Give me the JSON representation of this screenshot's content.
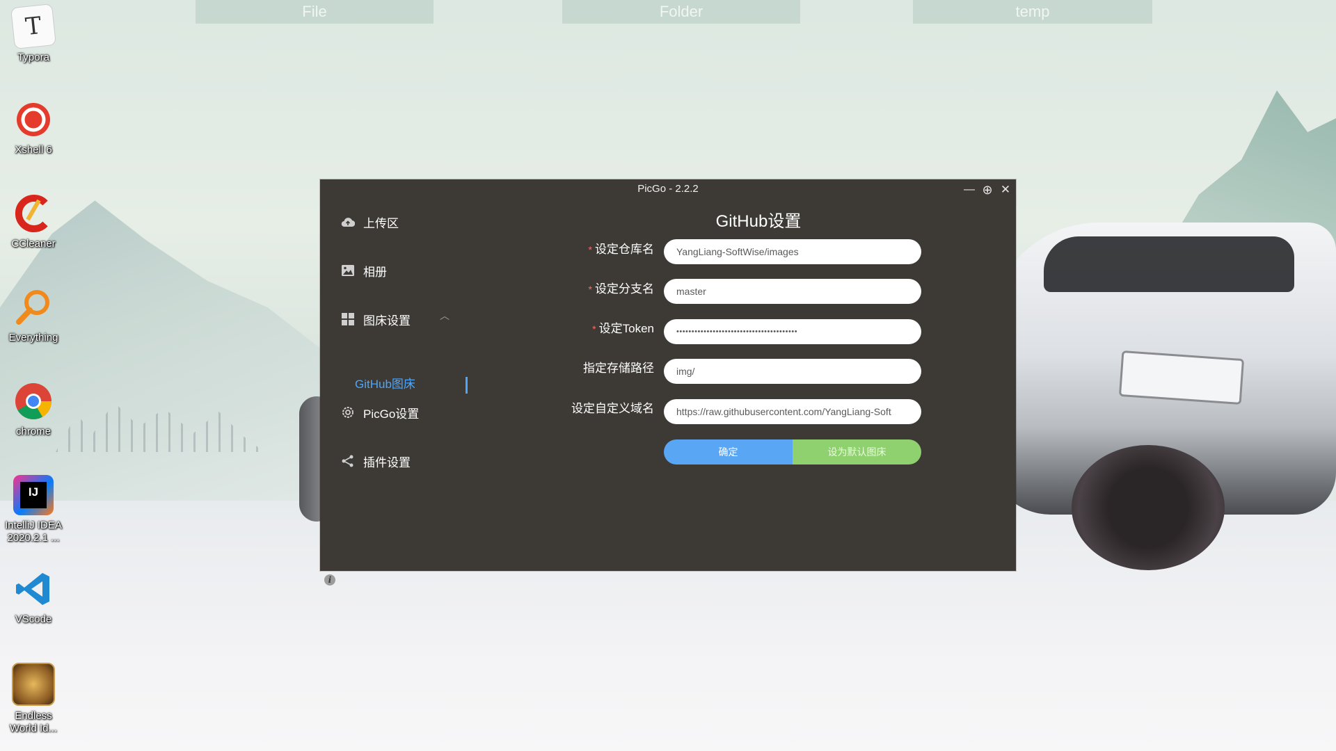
{
  "desktop": {
    "top_folders": [
      "File",
      "Folder",
      "temp"
    ],
    "icons": [
      {
        "label": "Typora",
        "icon": "typora-icon"
      },
      {
        "label": "Xshell 6",
        "icon": "xshell-icon"
      },
      {
        "label": "CCleaner",
        "icon": "ccleaner-icon"
      },
      {
        "label": "Everything",
        "icon": "everything-icon"
      },
      {
        "label": "chrome",
        "icon": "chrome-icon"
      },
      {
        "label": "IntelliJ IDEA\n2020.2.1 ...",
        "icon": "intellij-icon"
      },
      {
        "label": "VScode",
        "icon": "vscode-icon"
      },
      {
        "label": "Endless\nWorld Id...",
        "icon": "endless-world-icon"
      }
    ]
  },
  "window": {
    "title": "PicGo - 2.2.2",
    "controls": {
      "minimize": "—",
      "maximize": "⊕",
      "close": "✕"
    }
  },
  "sidebar": {
    "items": [
      {
        "label": "上传区",
        "icon": "cloud-upload-icon"
      },
      {
        "label": "相册",
        "icon": "picture-icon"
      },
      {
        "label": "图床设置",
        "icon": "grid-icon"
      },
      {
        "label": "PicGo设置",
        "icon": "gear-icon"
      },
      {
        "label": "插件设置",
        "icon": "share-icon"
      }
    ],
    "sub_item": "GitHub图床",
    "info": "i"
  },
  "form": {
    "title": "GitHub设置",
    "fields": [
      {
        "label": "设定仓库名",
        "required": true,
        "value": "YangLiang-SoftWise/images"
      },
      {
        "label": "设定分支名",
        "required": true,
        "value": "master"
      },
      {
        "label": "设定Token",
        "required": true,
        "value": "••••••••••••••••••••••••••••••••••••••••"
      },
      {
        "label": "指定存储路径",
        "required": false,
        "value": "img/"
      },
      {
        "label": "设定自定义域名",
        "required": false,
        "value": "https://raw.githubusercontent.com/YangLiang-Soft"
      }
    ],
    "required_mark": "*",
    "confirm_label": "确定",
    "default_label": "设为默认图床"
  }
}
